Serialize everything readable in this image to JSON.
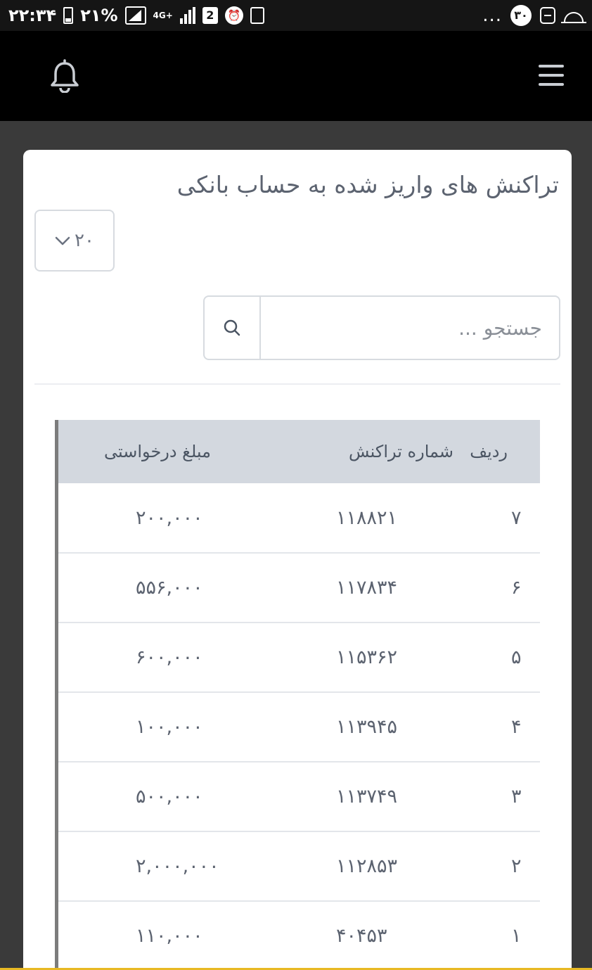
{
  "status_bar": {
    "time": "۲۲:۳۴",
    "battery": "۲۱%",
    "network": "4G+",
    "sim_slot": "2",
    "notification_count": "۳۰",
    "more": "..."
  },
  "page_title": "تراکنش های واریز شده به حساب بانکی",
  "page_size": {
    "selected": "۲۰"
  },
  "search": {
    "placeholder": "جستجو ..."
  },
  "table": {
    "headers": {
      "row": "ردیف",
      "transaction": "شماره تراکنش",
      "amount": "مبلغ درخواستی"
    },
    "rows": [
      {
        "row": "۷",
        "transaction": "۱۱۸۸۲۱",
        "amount": "۲۰۰,۰۰۰"
      },
      {
        "row": "۶",
        "transaction": "۱۱۷۸۳۴",
        "amount": "۵۵۶,۰۰۰"
      },
      {
        "row": "۵",
        "transaction": "۱۱۵۳۶۲",
        "amount": "۶۰۰,۰۰۰"
      },
      {
        "row": "۴",
        "transaction": "۱۱۳۹۴۵",
        "amount": "۱۰۰,۰۰۰"
      },
      {
        "row": "۳",
        "transaction": "۱۱۳۷۴۹",
        "amount": "۵۰۰,۰۰۰"
      },
      {
        "row": "۲",
        "transaction": "۱۱۲۸۵۳",
        "amount": "۲,۰۰۰,۰۰۰"
      },
      {
        "row": "۱",
        "transaction": "۴۰۴۵۳",
        "amount": "۱۱۰,۰۰۰"
      }
    ]
  }
}
